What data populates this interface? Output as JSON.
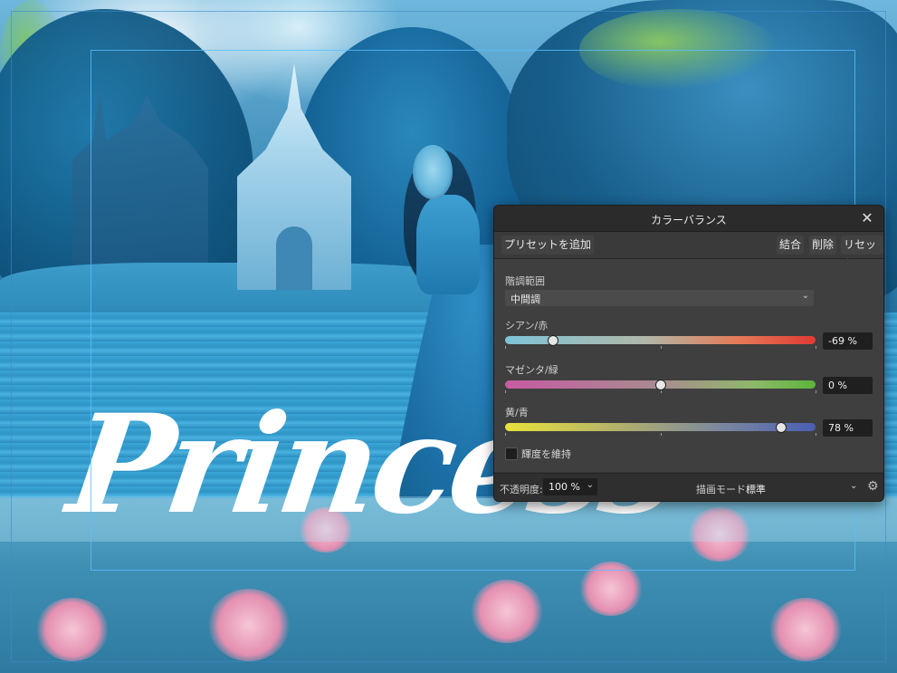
{
  "artwork": {
    "headline": "Princess"
  },
  "panel": {
    "title": "カラーバランス",
    "close_label": "✕",
    "toolbar": {
      "add_preset": "プリセットを追加",
      "merge": "結合",
      "delete": "削除",
      "reset": "リセット"
    },
    "tonal_range_label": "階調範囲",
    "tonal_range_value": "中間調",
    "sliders": [
      {
        "label": "シアン/赤",
        "value_text": "-69 %",
        "value": -69
      },
      {
        "label": "マゼンタ/緑",
        "value_text": "0 %",
        "value": 0
      },
      {
        "label": "黄/青",
        "value_text": "78 %",
        "value": 78
      }
    ],
    "preserve_luminosity_label": "輝度を維持",
    "preserve_luminosity_checked": false,
    "footer": {
      "opacity_label": "不透明度:",
      "opacity_value": "100 %",
      "blend_mode_label": "描画モード:",
      "blend_mode_value": "標準"
    }
  },
  "icons": {
    "close": "close-icon",
    "chevron": "chevron-down-icon",
    "settings": "gear-icon"
  }
}
